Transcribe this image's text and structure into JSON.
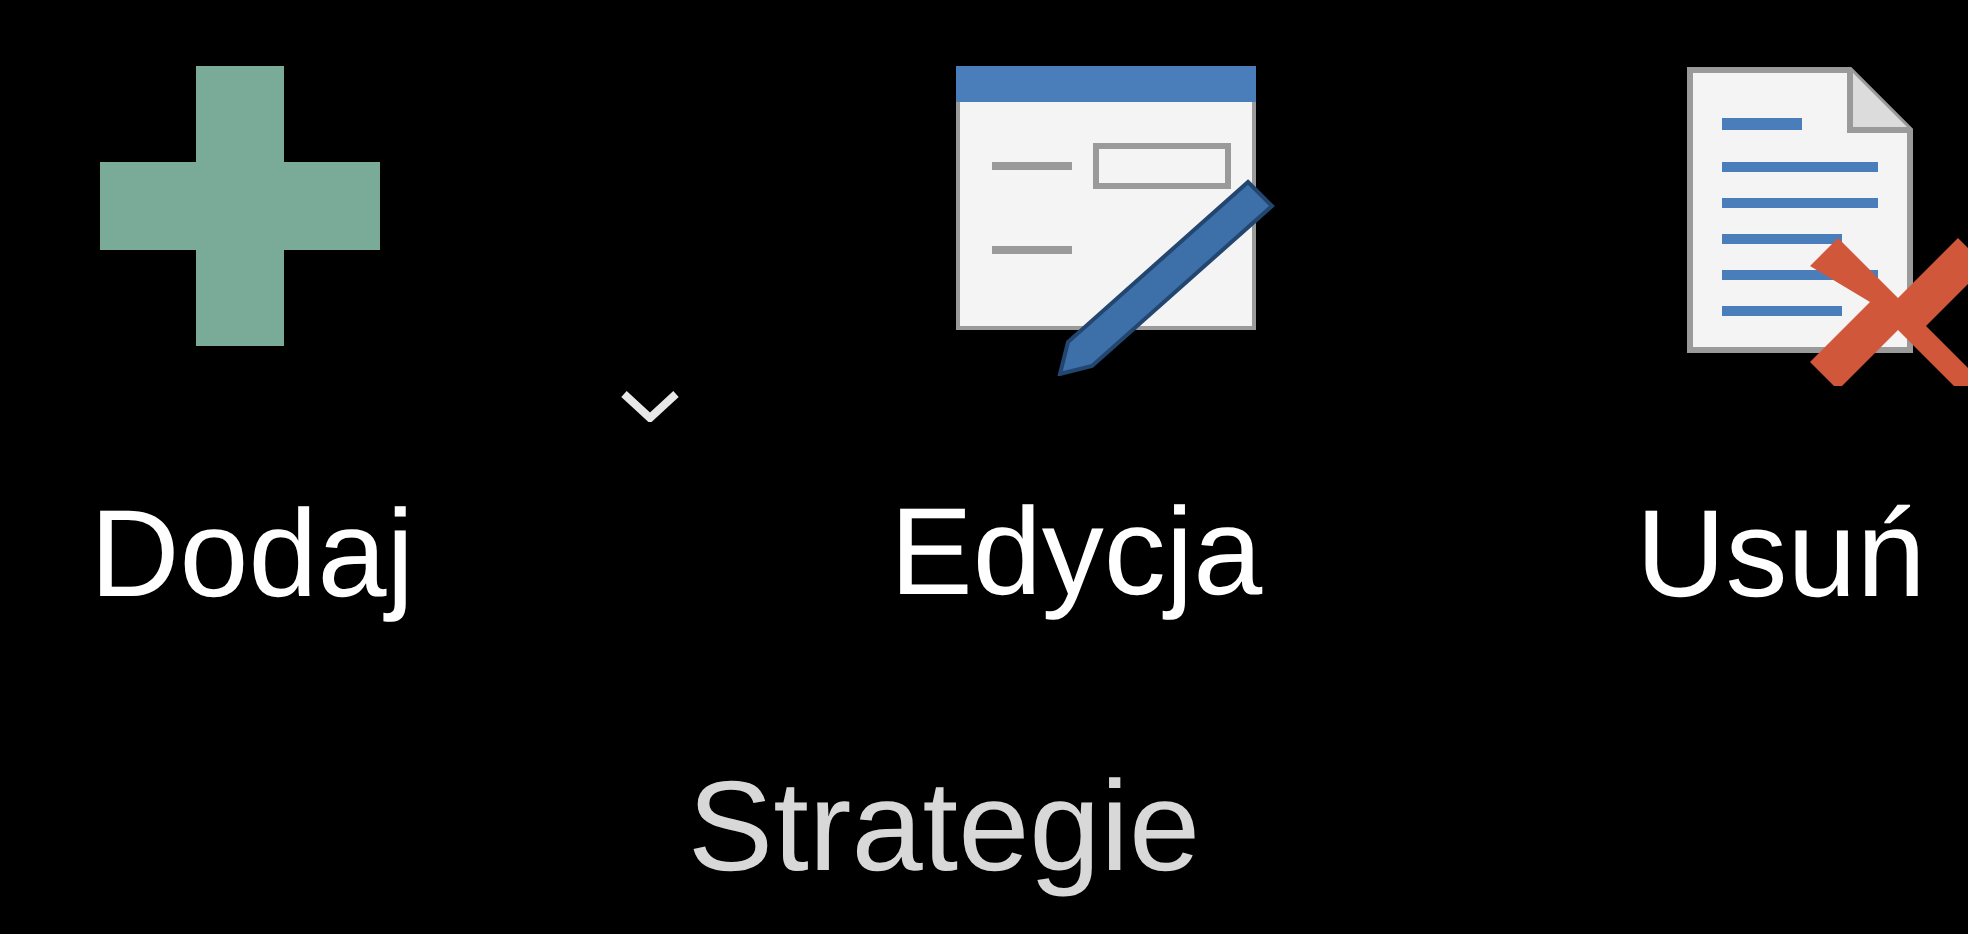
{
  "ribbon_group": {
    "label": "Strategie",
    "buttons": [
      {
        "kind": "add",
        "label": "Dodaj",
        "has_dropdown": true
      },
      {
        "kind": "edit",
        "label": "Edycja",
        "has_dropdown": false
      },
      {
        "kind": "delete",
        "label": "Usuń",
        "has_dropdown": false
      }
    ]
  }
}
